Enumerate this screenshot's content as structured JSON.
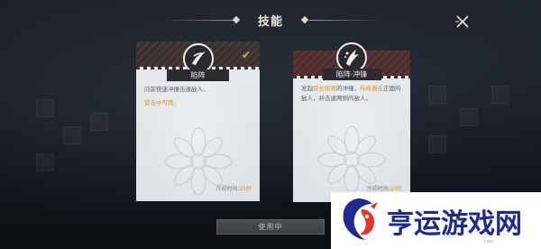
{
  "title": "技能",
  "close_icon": "close-x-icon",
  "cards": [
    {
      "name": "陷阵",
      "description": "向前快速冲撞击退敌人。",
      "note": "受击中可用。",
      "cooldown_label": "冷却时间:",
      "cooldown_value": "25秒",
      "selected": true,
      "emblem_icon": "slash-emblem-icon",
      "check_icon": "checkmark-icon"
    },
    {
      "name": "陷阵·冲锋",
      "description_prefix": "发起",
      "description_hl1": "较长距离",
      "description_mid": "的冲撞，",
      "description_hl2": "持续撞击",
      "description_suffix": "正面的敌人，并击退两侧的敌人。",
      "cooldown_label": "冷却时间:",
      "cooldown_value": "20秒",
      "selected": false,
      "emblem_icon": "charge-emblem-icon"
    }
  ],
  "action_button": "使用中",
  "watermark": {
    "text": "亨运游戏网",
    "domain": "com",
    "logo_icon": "dragon-logo-icon"
  },
  "colors": {
    "accent": "#d9962e",
    "card_bg": "#e3e6e9",
    "watermark_blue": "#1e2a8c"
  }
}
